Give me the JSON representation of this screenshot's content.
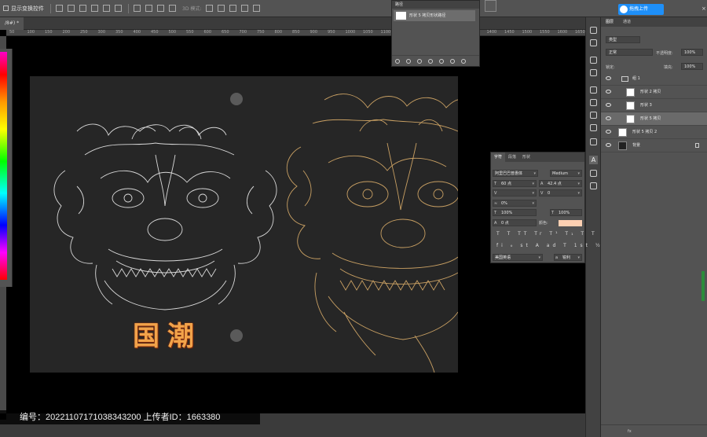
{
  "options_bar": {
    "show_transform_label": "显示变换控件",
    "mode_3d": "3D 模式:"
  },
  "document_tab": {
    "title": "/8#) *"
  },
  "ruler": {
    "ticks": [
      "50",
      "100",
      "150",
      "200",
      "250",
      "300",
      "350",
      "400",
      "450",
      "500",
      "550",
      "600",
      "650",
      "700",
      "750",
      "800",
      "850",
      "900",
      "950",
      "1000",
      "1050",
      "1100",
      "1150",
      "1200",
      "1250",
      "1300",
      "1350",
      "1400",
      "1450",
      "1500",
      "1550",
      "1600",
      "1650"
    ]
  },
  "paths_panel": {
    "title": "路径",
    "item_label": "形状 5 拷贝形状路径"
  },
  "upload": {
    "button_label": "拖拽上传"
  },
  "layers_panel": {
    "tabs": [
      "图层",
      "通道"
    ],
    "kind_filter": "类型",
    "blend_mode": "正常",
    "opacity_label": "不透明度:",
    "opacity_value": "100%",
    "lock_label": "锁定:",
    "fill_label": "填充:",
    "fill_value": "100%",
    "layers": [
      {
        "name": "组 1",
        "type": "group"
      },
      {
        "name": "形状 2 拷贝",
        "type": "shape"
      },
      {
        "name": "形状 3",
        "type": "shape"
      },
      {
        "name": "形状 5 拷贝",
        "type": "shape",
        "selected": true
      },
      {
        "name": "形状 5 拷贝 2",
        "type": "shape"
      },
      {
        "name": "背景",
        "type": "background",
        "locked": true
      }
    ],
    "footer_icons": "fx"
  },
  "character_panel": {
    "tabs": [
      "字符",
      "段落",
      "形状"
    ],
    "font_family": "阿里巴巴普惠体",
    "font_style": "Medium",
    "font_size": "60 点",
    "leading": "42.4 点",
    "kerning": "",
    "tracking": "0",
    "scale_label": "0%",
    "vertical_scale": "100%",
    "horizontal_scale": "100%",
    "baseline_shift": "0 点",
    "color_label": "颜色:",
    "color_value": "#fdd0b2",
    "style_buttons": "T T TT Tr T¹ T₁ T T",
    "opentype_buttons": "fi ℴ st A ad T 1st ½",
    "language": "美国英语",
    "antialias": "锐利"
  },
  "artwork": {
    "title_text": "国潮",
    "title_color": "#f2a34a",
    "left_lion_color": "#d8d8d8",
    "right_lion_color": "#c9a063"
  },
  "watermark": {
    "text": "编号：20221107171038343200 上传者ID：1663380"
  }
}
